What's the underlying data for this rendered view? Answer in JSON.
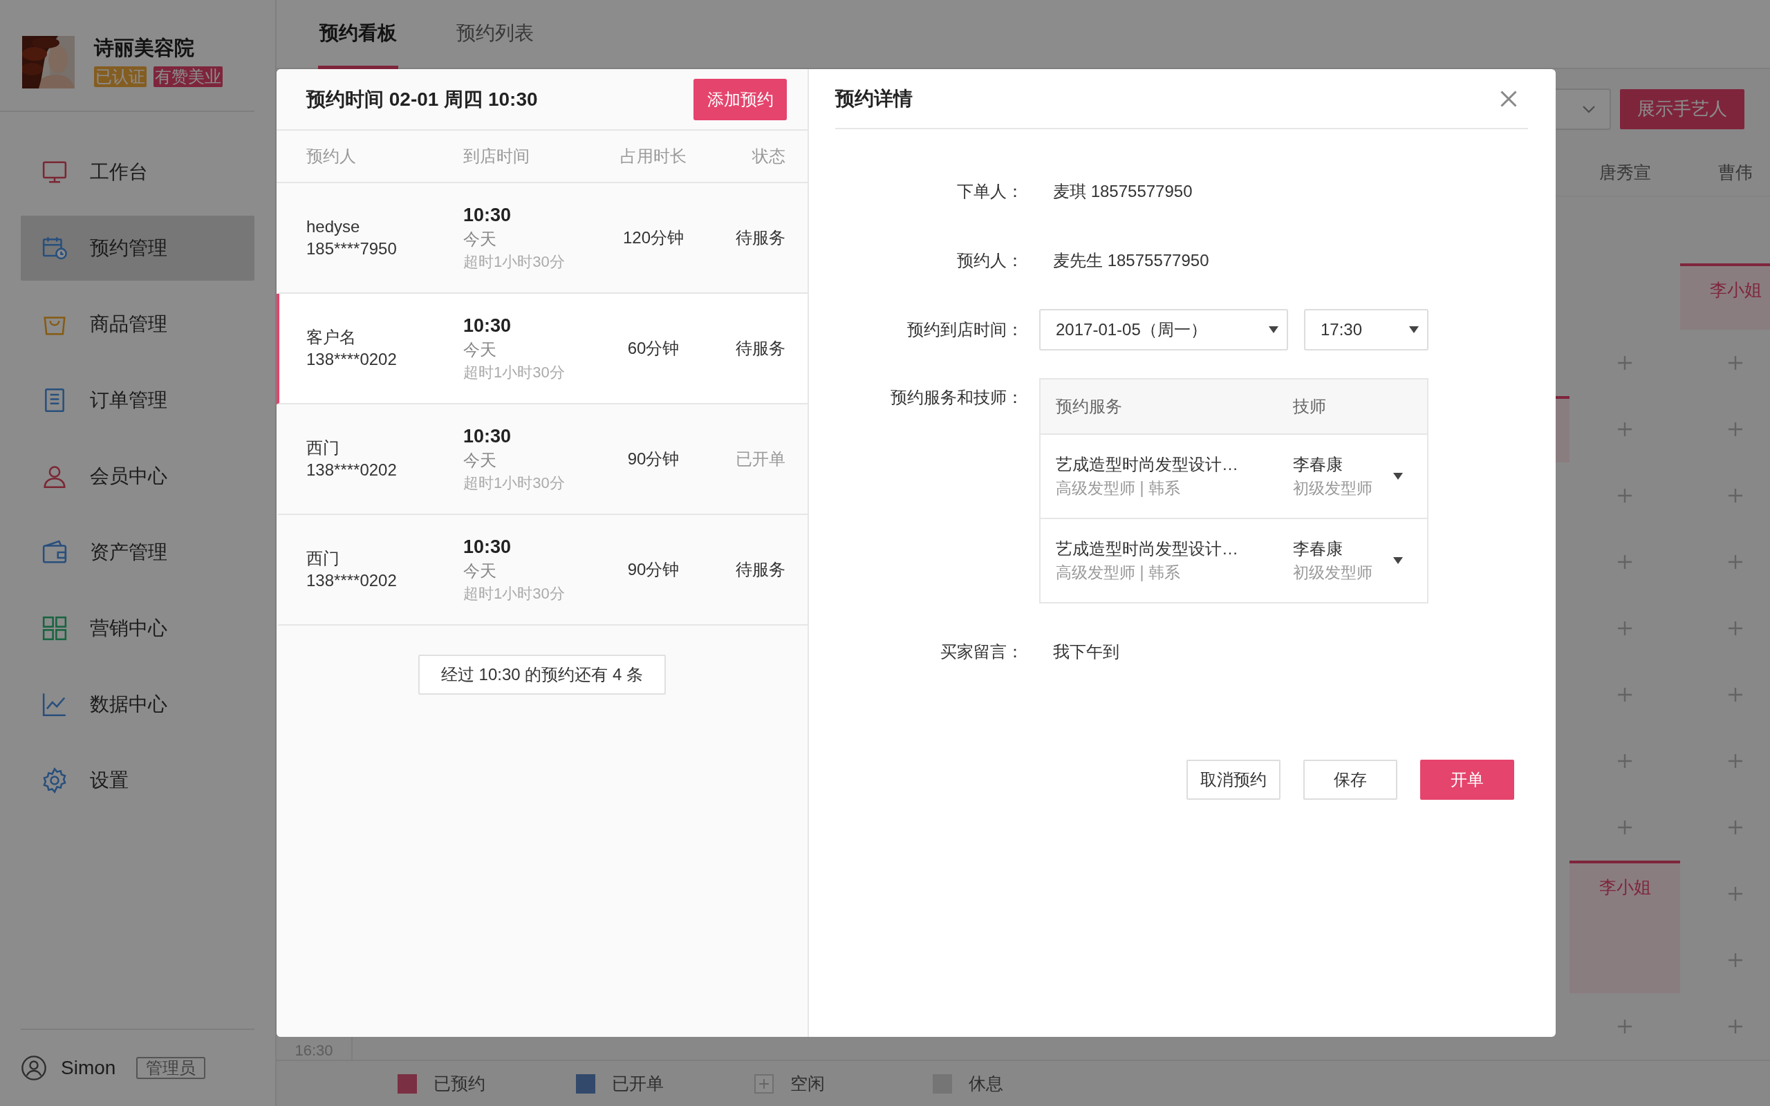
{
  "sidebar": {
    "store_name": "诗丽美容院",
    "badges": [
      {
        "label": "已认证",
        "kind": "certified"
      },
      {
        "label": "有赞美业",
        "kind": "brand"
      }
    ],
    "nav": [
      {
        "label": "工作台",
        "kind": "workbench",
        "selected": false
      },
      {
        "label": "预约管理",
        "kind": "booking",
        "selected": true
      },
      {
        "label": "商品管理",
        "kind": "goods",
        "selected": false
      },
      {
        "label": "订单管理",
        "kind": "orders",
        "selected": false
      },
      {
        "label": "会员中心",
        "kind": "members",
        "selected": false
      },
      {
        "label": "资产管理",
        "kind": "assets",
        "selected": false
      },
      {
        "label": "营销中心",
        "kind": "marketing",
        "selected": false
      },
      {
        "label": "数据中心",
        "kind": "data",
        "selected": false
      },
      {
        "label": "设置",
        "kind": "settings",
        "selected": false
      }
    ],
    "user": {
      "name": "Simon",
      "role": "管理员"
    }
  },
  "tabs": [
    {
      "label": "预约看板",
      "selected": true
    },
    {
      "label": "预约列表",
      "selected": false
    }
  ],
  "toolbar": {
    "button": "展示手艺人"
  },
  "schedule": {
    "time_labels": [
      "16:30"
    ],
    "columns": [
      {
        "slots": [
          {
            "kind": "empty"
          },
          {
            "kind": "empty"
          },
          {
            "kind": "empty"
          },
          {
            "kind": "booked"
          },
          {
            "kind": "empty"
          },
          {
            "kind": "empty"
          },
          {
            "kind": "empty"
          },
          {
            "kind": "empty"
          },
          {
            "kind": "empty"
          },
          {
            "kind": "empty"
          },
          {
            "kind": "empty"
          },
          {
            "kind": "empty"
          },
          {
            "kind": "empty"
          }
        ]
      },
      {
        "name": "唐秀宣",
        "slots": [
          {
            "kind": "empty"
          },
          {
            "kind": "empty"
          },
          {
            "kind": "free"
          },
          {
            "kind": "free"
          },
          {
            "kind": "free"
          },
          {
            "kind": "free"
          },
          {
            "kind": "free"
          },
          {
            "kind": "free"
          },
          {
            "kind": "free"
          },
          {
            "kind": "free"
          },
          {
            "kind": "booked",
            "label": "李小姐"
          },
          {
            "kind": "continued"
          },
          {
            "kind": "free"
          }
        ]
      },
      {
        "name": "曹伟",
        "slots": [
          {
            "kind": "empty"
          },
          {
            "kind": "booked",
            "label": "李小姐"
          },
          {
            "kind": "free"
          },
          {
            "kind": "free"
          },
          {
            "kind": "free"
          },
          {
            "kind": "free"
          },
          {
            "kind": "free"
          },
          {
            "kind": "free"
          },
          {
            "kind": "free"
          },
          {
            "kind": "free"
          },
          {
            "kind": "free"
          },
          {
            "kind": "free"
          },
          {
            "kind": "free"
          }
        ]
      }
    ]
  },
  "legend": [
    {
      "label": "已预约",
      "kind": "booked"
    },
    {
      "label": "已开单",
      "kind": "opened"
    },
    {
      "label": "空闲",
      "kind": "free"
    },
    {
      "label": "休息",
      "kind": "rest"
    }
  ],
  "modal": {
    "list": {
      "title": "预约时间 02-01 周四 10:30",
      "add_button": "添加预约",
      "columns": [
        "预约人",
        "到店时间",
        "占用时长",
        "状态"
      ],
      "rows": [
        {
          "name": "hedyse",
          "phone": "185****7950",
          "time": "10:30",
          "day": "今天",
          "overtime": "超时1小时30分",
          "duration": "120分钟",
          "status": "待服务",
          "kind": "pending",
          "selected": false
        },
        {
          "name": "客户名",
          "phone": "138****0202",
          "time": "10:30",
          "day": "今天",
          "overtime": "超时1小时30分",
          "duration": "60分钟",
          "status": "待服务",
          "kind": "pending",
          "selected": true
        },
        {
          "name": "西门",
          "phone": "138****0202",
          "time": "10:30",
          "day": "今天",
          "overtime": "超时1小时30分",
          "duration": "90分钟",
          "status": "已开单",
          "kind": "opened",
          "selected": false
        },
        {
          "name": "西门",
          "phone": "138****0202",
          "time": "10:30",
          "day": "今天",
          "overtime": "超时1小时30分",
          "duration": "90分钟",
          "status": "待服务",
          "kind": "pending",
          "selected": false
        }
      ],
      "more_button": "经过 10:30 的预约还有 4 条"
    },
    "detail": {
      "title": "预约详情",
      "orderer": {
        "label": "下单人：",
        "value": "麦琪 18575577950"
      },
      "booker": {
        "label": "预约人：",
        "value": "麦先生 18575577950"
      },
      "arrival": {
        "label": "预约到店时间：",
        "date": "2017-01-05（周一）",
        "time": "17:30"
      },
      "services": {
        "label": "预约服务和技师：",
        "columns": [
          "预约服务",
          "技师"
        ],
        "rows": [
          {
            "service": "艺成造型时尚发型设计…",
            "detail": "高级发型师 | 韩系",
            "technician": "李春康",
            "tech_title": "初级发型师"
          },
          {
            "service": "艺成造型时尚发型设计…",
            "detail": "高级发型师 | 韩系",
            "technician": "李春康",
            "tech_title": "初级发型师"
          }
        ]
      },
      "note": {
        "label": "买家留言：",
        "value": "我下午到"
      },
      "buttons": [
        {
          "label": "取消预约",
          "kind": "default"
        },
        {
          "label": "保存",
          "kind": "default"
        },
        {
          "label": "开单",
          "kind": "primary"
        }
      ]
    }
  }
}
